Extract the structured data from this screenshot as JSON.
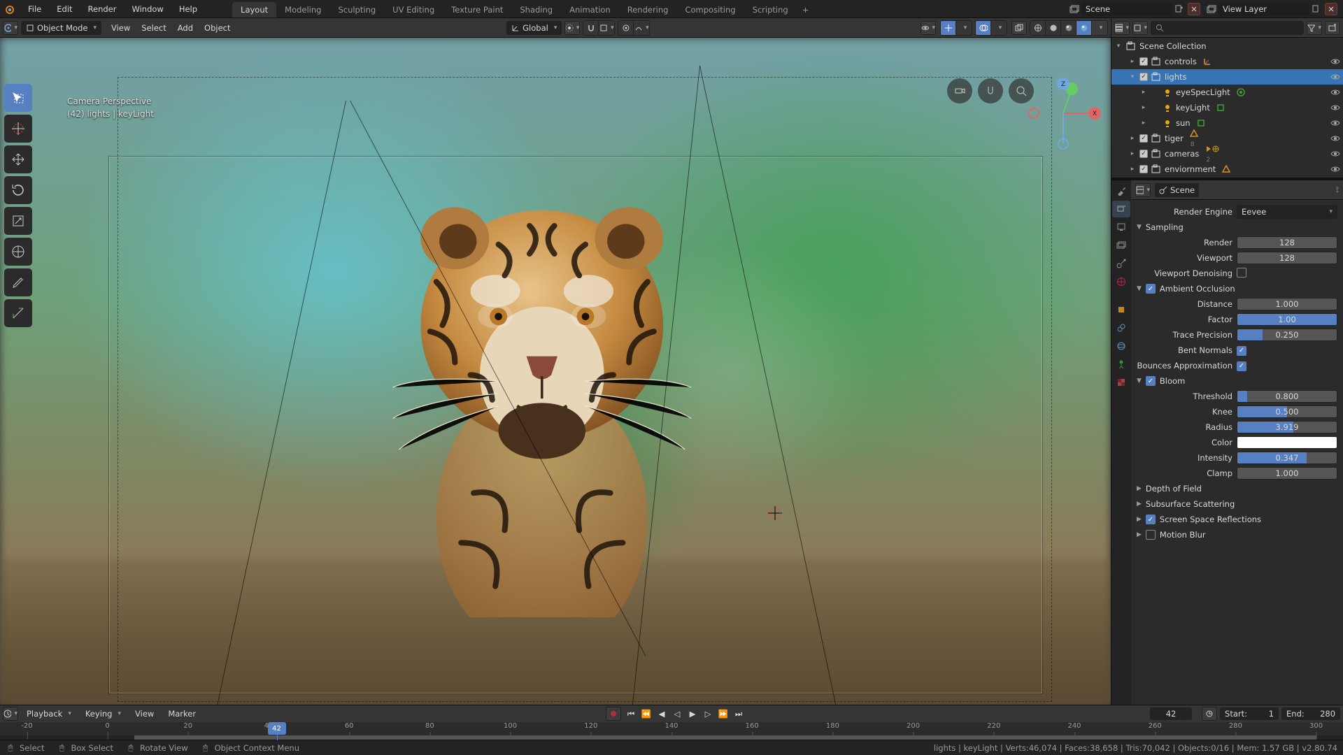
{
  "top_menu": {
    "items": [
      "File",
      "Edit",
      "Render",
      "Window",
      "Help"
    ]
  },
  "workspaces": {
    "tabs": [
      "Layout",
      "Modeling",
      "Sculpting",
      "UV Editing",
      "Texture Paint",
      "Shading",
      "Animation",
      "Rendering",
      "Compositing",
      "Scripting"
    ],
    "active": 0
  },
  "scene_selector": {
    "label": "Scene"
  },
  "layer_selector": {
    "label": "View Layer"
  },
  "viewport_header": {
    "mode": "Object Mode",
    "menus": [
      "View",
      "Select",
      "Add",
      "Object"
    ],
    "orientation": "Global"
  },
  "viewport_overlay": {
    "line1": "Camera Perspective",
    "line2": "(42) lights | keyLight"
  },
  "outliner": {
    "root": "Scene Collection",
    "items": [
      {
        "indent": 1,
        "exp": false,
        "cb": true,
        "type": "coll",
        "label": "controls",
        "after": "axes",
        "eye": true
      },
      {
        "indent": 1,
        "exp": true,
        "cb": true,
        "type": "coll",
        "label": "lights",
        "after": "",
        "eye": true,
        "sel": true
      },
      {
        "indent": 2,
        "exp": false,
        "cb": null,
        "type": "light",
        "label": "eyeSpecLight",
        "after": "green",
        "eye": true
      },
      {
        "indent": 2,
        "exp": false,
        "cb": null,
        "type": "light",
        "label": "keyLight",
        "after": "green-sq",
        "eye": true
      },
      {
        "indent": 2,
        "exp": false,
        "cb": null,
        "type": "light",
        "label": "sun",
        "after": "green-sq",
        "eye": true
      },
      {
        "indent": 1,
        "exp": false,
        "cb": true,
        "type": "coll",
        "label": "tiger",
        "after": "mesh8",
        "eye": true
      },
      {
        "indent": 1,
        "exp": false,
        "cb": true,
        "type": "coll",
        "label": "cameras",
        "after": "cam",
        "eye": true
      },
      {
        "indent": 1,
        "exp": false,
        "cb": true,
        "type": "coll",
        "label": "enviornment",
        "after": "mesh",
        "eye": true
      }
    ]
  },
  "properties": {
    "breadcrumb": "Scene",
    "render_engine": {
      "label": "Render Engine",
      "value": "Eevee"
    },
    "panels": {
      "sampling": {
        "title": "Sampling",
        "render_label": "Render",
        "render": "128",
        "viewport_label": "Viewport",
        "viewport": "128",
        "denoise_label": "Viewport Denoising",
        "denoise": false
      },
      "ao": {
        "title": "Ambient Occlusion",
        "on": true,
        "distance_label": "Distance",
        "distance": "1.000",
        "factor_label": "Factor",
        "factor": "1.00",
        "factor_fill": 100,
        "trace_label": "Trace Precision",
        "trace": "0.250",
        "trace_fill": 25,
        "bent_label": "Bent Normals",
        "bent": true,
        "bounce_label": "Bounces Approximation",
        "bounce": true
      },
      "bloom": {
        "title": "Bloom",
        "on": true,
        "threshold_label": "Threshold",
        "threshold": "0.800",
        "threshold_fill": 10,
        "knee_label": "Knee",
        "knee": "0.500",
        "knee_fill": 50,
        "radius_label": "Radius",
        "radius": "3.919",
        "radius_fill": 56,
        "color_label": "Color",
        "color": "#ffffff",
        "intensity_label": "Intensity",
        "intensity": "0.347",
        "intensity_fill": 70,
        "clamp_label": "Clamp",
        "clamp": "1.000"
      },
      "dof": {
        "title": "Depth of Field"
      },
      "sss": {
        "title": "Subsurface Scattering"
      },
      "ssr": {
        "title": "Screen Space Reflections",
        "on": true
      },
      "mb": {
        "title": "Motion Blur",
        "on": false
      }
    }
  },
  "timeline": {
    "menus": [
      "Playback",
      "Keying",
      "View",
      "Marker"
    ],
    "current": "42",
    "start_label": "Start:",
    "start": "1",
    "end_label": "End:",
    "end": "280",
    "ticks": [
      "-20",
      "0",
      "20",
      "40",
      "60",
      "80",
      "100",
      "120",
      "140",
      "160",
      "180",
      "200",
      "220",
      "240",
      "260",
      "280",
      "300"
    ]
  },
  "statusbar": {
    "select": "Select",
    "box": "Box Select",
    "rotate": "Rotate View",
    "context": "Object Context Menu",
    "right": "lights | keyLight | Verts:46,074 | Faces:38,658 | Tris:70,042 | Objects:0/16 | Mem: 1.57 GB | v2.80.74"
  }
}
